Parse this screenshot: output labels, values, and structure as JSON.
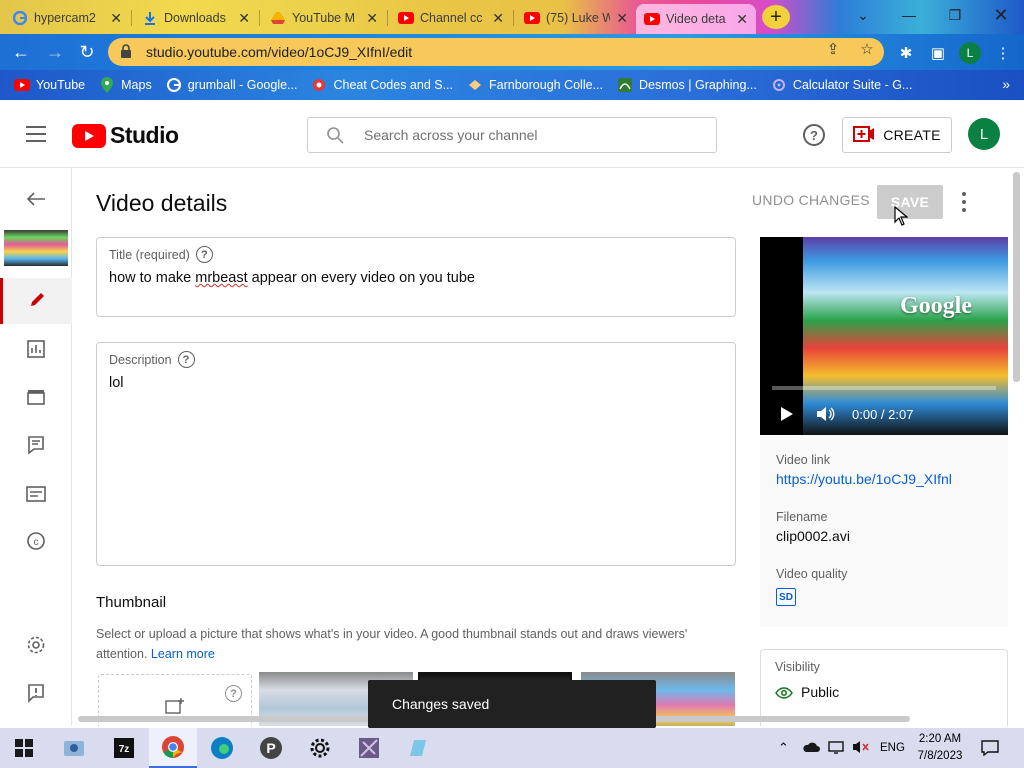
{
  "browser": {
    "tabs": [
      {
        "title": "hypercam2",
        "icon": "google-icon"
      },
      {
        "title": "Downloads",
        "icon": "download-icon"
      },
      {
        "title": "YouTube M",
        "icon": "drive-icon"
      },
      {
        "title": "Channel cc",
        "icon": "youtube-icon"
      },
      {
        "title": "(75) Luke W",
        "icon": "youtube-icon"
      },
      {
        "title": "Video deta",
        "icon": "youtube-icon"
      }
    ],
    "url": "studio.youtube.com/video/1oCJ9_XIfnI/edit",
    "profile_initial": "L",
    "bookmarks": [
      {
        "label": "YouTube",
        "icon": "youtube-icon"
      },
      {
        "label": "Maps",
        "icon": "maps-icon"
      },
      {
        "label": "grumball - Google...",
        "icon": "google-icon"
      },
      {
        "label": "Cheat Codes and S...",
        "icon": "cheat-codes-icon"
      },
      {
        "label": "Farnborough Colle...",
        "icon": "college-icon"
      },
      {
        "label": "Desmos | Graphing...",
        "icon": "desmos-icon"
      },
      {
        "label": "Calculator Suite - G...",
        "icon": "calculator-suite-icon"
      }
    ],
    "bookmarks_more": "»"
  },
  "studio": {
    "logo_text": "Studio",
    "search_placeholder": "Search across your channel",
    "create_label": "CREATE",
    "avatar_initial": "L"
  },
  "page": {
    "title": "Video details",
    "undo_label": "UNDO CHANGES",
    "save_label": "SAVE",
    "title_field": {
      "label": "Title (required)",
      "value_before": "how to make ",
      "value_misspelled": "mrbeast",
      "value_after": " appear on every video on you tube"
    },
    "description_field": {
      "label": "Description",
      "value": "lol"
    },
    "thumbnail": {
      "heading": "Thumbnail",
      "text": "Select or upload a picture that shows what's in your video. A good thumbnail stands out and draws viewers' attention.",
      "learn_more": "Learn more"
    },
    "preview": {
      "time": "0:00 / 2:07"
    },
    "info": {
      "link_label": "Video link",
      "link_value": "https://youtu.be/1oCJ9_XIfnl",
      "filename_label": "Filename",
      "filename_value": "clip0002.avi",
      "quality_label": "Video quality",
      "quality_badge": "SD"
    },
    "visibility": {
      "label": "Visibility",
      "value": "Public"
    },
    "toast": "Changes saved"
  },
  "taskbar": {
    "language": "ENG",
    "time": "2:20 AM",
    "date": "7/8/2023"
  },
  "colors": {
    "youtube_red": "#ff0000",
    "active_nav_red": "#cc0000",
    "link_blue": "#065fd4",
    "avatar_green": "#0b8043"
  }
}
